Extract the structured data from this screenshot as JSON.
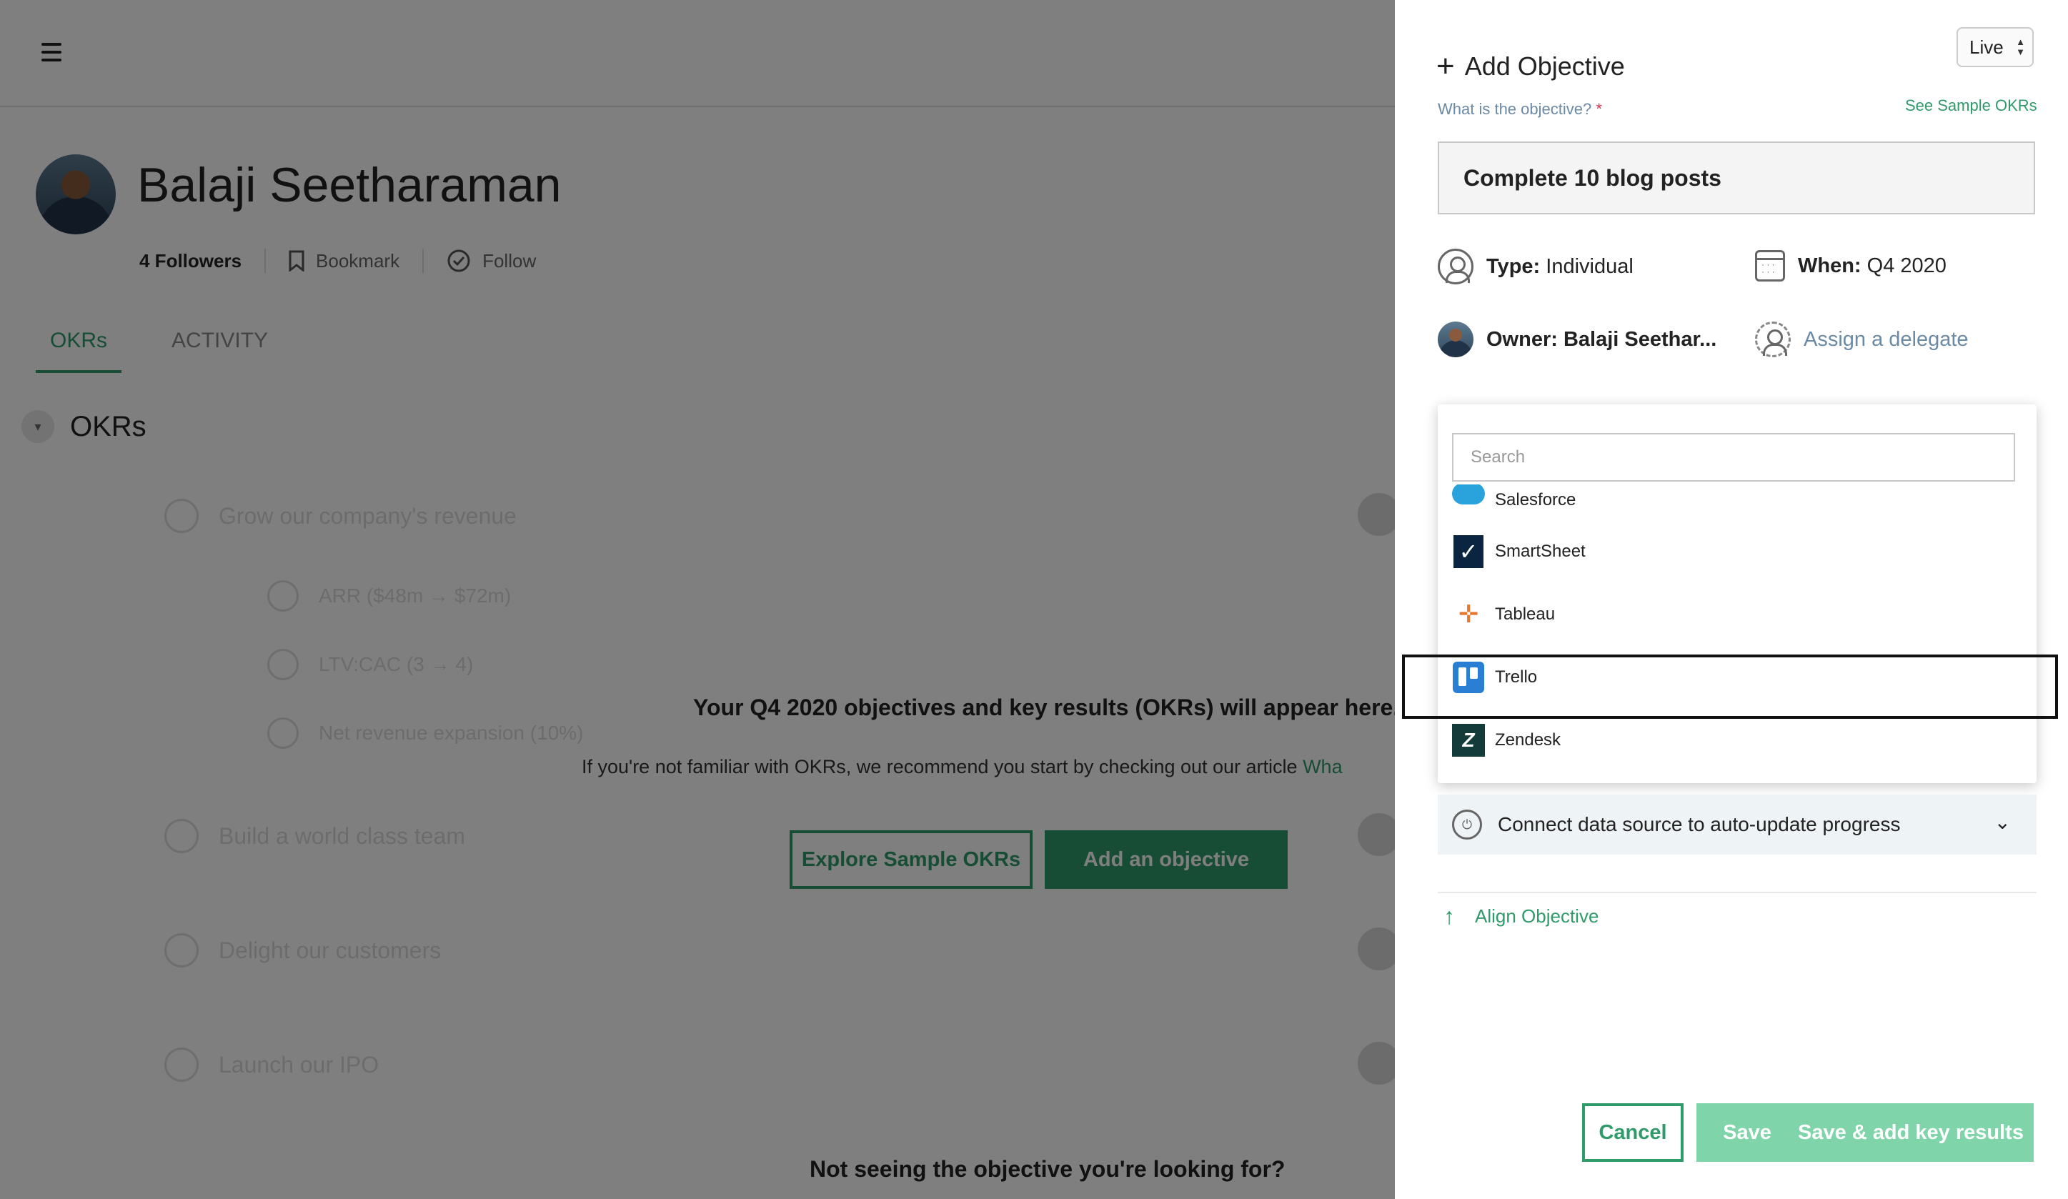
{
  "profile": {
    "name": "Balaji Seetharaman",
    "followers": "4 Followers",
    "bookmark": "Bookmark",
    "follow": "Follow"
  },
  "tabs": [
    {
      "label": "OKRs",
      "active": true
    },
    {
      "label": "ACTIVITY",
      "active": false
    }
  ],
  "okrs": {
    "title": "OKRs",
    "ghost_items": [
      {
        "label": "Grow our company's revenue"
      },
      {
        "label": "ARR ($48m → $72m)"
      },
      {
        "label": "LTV:CAC (3 → 4)"
      },
      {
        "label": "Net revenue expansion (10%)"
      },
      {
        "label": "Build a world class team"
      },
      {
        "label": "Delight our customers"
      },
      {
        "label": "Launch our IPO"
      }
    ]
  },
  "empty_state": {
    "title": "Your Q4 2020 objectives and key results (OKRs) will appear here.",
    "subtitle": "If you're not familiar with OKRs, we recommend you start by checking out our article",
    "subtitle_link": "Wha",
    "explore_button": "Explore Sample OKRs",
    "add_button": "Add an objective",
    "not_seeing": "Not seeing the objective you're looking for?"
  },
  "panel": {
    "status_select": "Live",
    "title": "Add Objective",
    "question": "What is the objective?",
    "required_mark": "*",
    "see_samples": "See Sample OKRs",
    "objective_value": "Complete 10 blog posts",
    "type_label": "Type:",
    "type_value": "Individual",
    "when_label": "When:",
    "when_value": "Q4 2020",
    "owner_label": "Owner:",
    "owner_value": "Balaji Seethar...",
    "delegate": "Assign a delegate",
    "dropdown": {
      "search_placeholder": "Search",
      "items": [
        {
          "label": "Salesforce",
          "icon": "salesforce-logo-icon"
        },
        {
          "label": "SmartSheet",
          "icon": "smartsheet-logo-icon"
        },
        {
          "label": "Tableau",
          "icon": "tableau-logo-icon"
        },
        {
          "label": "Trello",
          "icon": "trello-logo-icon",
          "highlighted": true
        },
        {
          "label": "Zendesk",
          "icon": "zendesk-logo-icon"
        }
      ]
    },
    "connect_label": "Connect data source to auto-update progress",
    "align_label": "Align Objective",
    "cancel": "Cancel",
    "save": "Save",
    "save_add": "Save & add key results"
  },
  "colors": {
    "accent": "#2f9a6a",
    "accent_light": "#7fd4aa",
    "muted_label": "#6b8aa5",
    "required": "#e0334c"
  }
}
